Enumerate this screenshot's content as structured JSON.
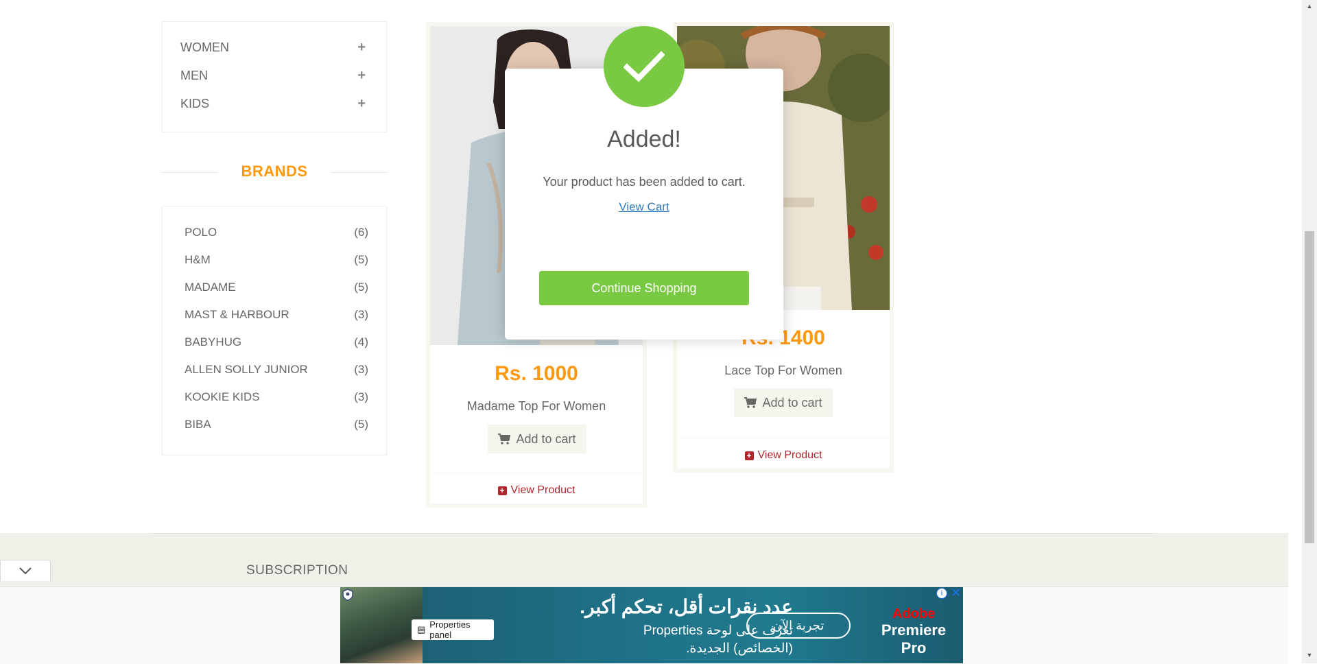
{
  "categories": [
    {
      "label": "WOMEN",
      "icon": "plus-icon"
    },
    {
      "label": "MEN",
      "icon": "plus-icon"
    },
    {
      "label": "KIDS",
      "icon": "plus-icon"
    }
  ],
  "brands": {
    "title": "BRANDS",
    "items": [
      {
        "name": "POLO",
        "count": "(6)"
      },
      {
        "name": "H&M",
        "count": "(5)"
      },
      {
        "name": "MADAME",
        "count": "(5)"
      },
      {
        "name": "MAST & HARBOUR",
        "count": "(3)"
      },
      {
        "name": "BABYHUG",
        "count": "(4)"
      },
      {
        "name": "ALLEN SOLLY JUNIOR",
        "count": "(3)"
      },
      {
        "name": "KOOKIE KIDS",
        "count": "(3)"
      },
      {
        "name": "BIBA",
        "count": "(5)"
      }
    ]
  },
  "products": [
    {
      "price": "Rs. 1000",
      "name": "Madame Top For Women",
      "add_label": "Add to cart",
      "view_label": "View Product"
    },
    {
      "price": "Rs. 1400",
      "name": "Lace Top For Women",
      "add_label": "Add to cart",
      "view_label": "View Product"
    }
  ],
  "modal": {
    "title": "Added!",
    "message": "Your product has been added to cart.",
    "link": "View Cart",
    "button": "Continue Shopping"
  },
  "footer": {
    "subscription": "SUBSCRIPTION"
  },
  "ad": {
    "panel_label": "Properties panel",
    "headline": "عدد نقرات أقل، تحكم أكبر.",
    "line2": "تعرّف على لوحة Properties",
    "line3": "(الخصائص) الجديدة.",
    "cta": "تجربة الآن",
    "brand_top": "Adobe",
    "brand": "Premiere Pro"
  },
  "colors": {
    "accent": "#fe980f",
    "success": "#7ac943",
    "link": "#337ab7",
    "view_product": "#b0272d"
  }
}
